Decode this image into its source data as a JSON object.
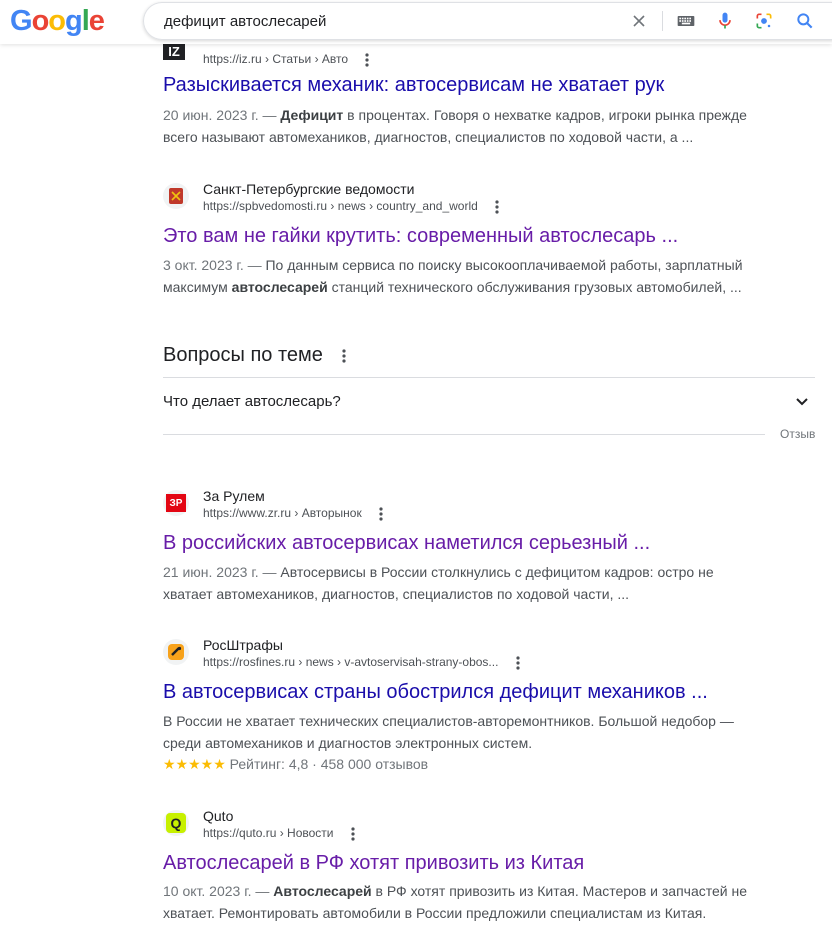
{
  "header": {
    "logo": [
      "G",
      "o",
      "o",
      "g",
      "l",
      "e"
    ],
    "logo_colors": [
      "#4285F4",
      "#EA4335",
      "#FBBC05",
      "#4285F4",
      "#34A853",
      "#EA4335"
    ],
    "search_query": "дефицит автослесарей"
  },
  "results": [
    {
      "favicon_text": "IZ",
      "site_name": "",
      "url": "https://iz.ru › Статьи › Авто",
      "title": "Разыскивается механик: автосервисам не хватает рук",
      "date": "20 июн. 2023 г. — ",
      "snippet_1_bold": "Дефицит",
      "snippet_1": " в процентах. Говоря о нехватке кадров, игроки рынка прежде",
      "snippet_2": "всего называют автомехаников, диагностов, специалистов по ходовой части, а ..."
    },
    {
      "site_name": "Санкт-Петербургские ведомости",
      "url": "https://spbvedomosti.ru › news › country_and_world",
      "title": "Это вам не гайки крутить: современный автослесарь ...",
      "date": "3 окт. 2023 г. — ",
      "snippet_1": "По данным сервиса по поиску высокооплачиваемой работы, зарплатный",
      "snippet_2_pre": "максимум ",
      "snippet_2_bold": "автослесарей",
      "snippet_2": " станций технического обслуживания грузовых автомобилей, ..."
    },
    {
      "favicon_text": "ЗР",
      "site_name": "За Рулем",
      "url": "https://www.zr.ru › Авторынок",
      "title": "В российских автосервисах наметился серьезный ...",
      "date": "21 июн. 2023 г. — ",
      "snippet_1": "Автосервисы в России столкнулись с дефицитом кадров: остро не",
      "snippet_2": "хватает автомехаников, диагностов, специалистов по ходовой части, ..."
    },
    {
      "site_name": "РосШтрафы",
      "url": "https://rosfines.ru › news › v-avtoservisah-strany-obos...",
      "title": "В автосервисах страны обострился дефицит механиков ...",
      "snippet_1": "В России не хватает технических специалистов-авторемонтников. Большой недобор —",
      "snippet_2": "среди автомехаников и диагностов электронных систем.",
      "stars": "★★★★★",
      "rating": 4.8,
      "rating_text": " Рейтинг: 4,8 · 458 000 отзывов"
    },
    {
      "favicon_text": "Q",
      "site_name": "Quto",
      "url": "https://quto.ru › Новости",
      "title": "Автослесарей в РФ хотят привозить из Китая",
      "date": "10 окт. 2023 г. — ",
      "snippet_1_bold": "Автослесарей",
      "snippet_1": " в РФ хотят привозить из Китая. Мастеров и запчастей не",
      "snippet_2": "хватает. Ремонтировать автомобили в России предложили специалистам из Китая."
    }
  ],
  "paa": {
    "title": "Вопросы по теме",
    "question": "Что делает автослесарь?",
    "feedback": "Отзыв"
  }
}
